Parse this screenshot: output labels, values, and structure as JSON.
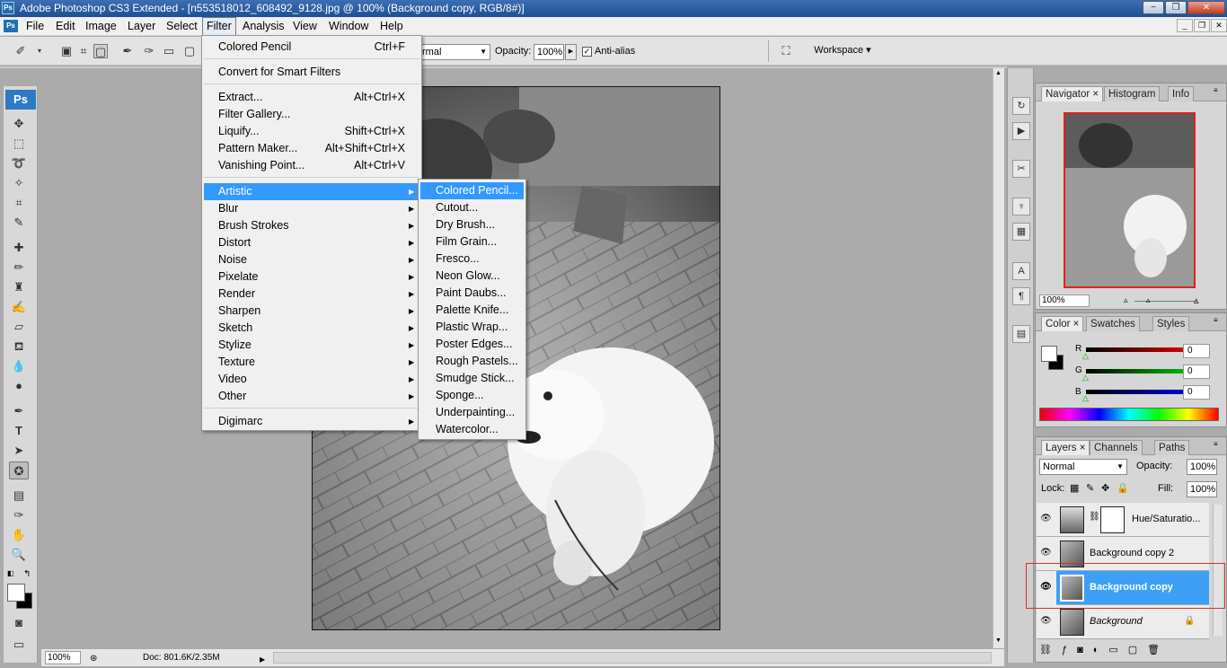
{
  "window": {
    "title": "Adobe Photoshop CS3 Extended - [n553518012_608492_9128.jpg @ 100% (Background copy, RGB/8#)]",
    "app_icon": "Ps",
    "minimize": "−",
    "restore": "❐",
    "close": "✕"
  },
  "menubar": {
    "items": [
      "File",
      "Edit",
      "Image",
      "Layer",
      "Select",
      "Filter",
      "Analysis",
      "View",
      "Window",
      "Help"
    ],
    "active": "Filter"
  },
  "options": {
    "mode_value": "rmal",
    "opacity_label": "Opacity:",
    "opacity_value": "100%",
    "antialias_label": "Anti-alias",
    "antialias_checked": true,
    "workspace_label": "Workspace ▾"
  },
  "filter_menu": {
    "last_filter": {
      "label": "Colored Pencil",
      "shortcut": "Ctrl+F"
    },
    "convert": "Convert for Smart Filters",
    "group1": [
      {
        "label": "Extract...",
        "shortcut": "Alt+Ctrl+X"
      },
      {
        "label": "Filter Gallery...",
        "shortcut": ""
      },
      {
        "label": "Liquify...",
        "shortcut": "Shift+Ctrl+X"
      },
      {
        "label": "Pattern Maker...",
        "shortcut": "Alt+Shift+Ctrl+X"
      },
      {
        "label": "Vanishing Point...",
        "shortcut": "Alt+Ctrl+V"
      }
    ],
    "submenus": [
      "Artistic",
      "Blur",
      "Brush Strokes",
      "Distort",
      "Noise",
      "Pixelate",
      "Render",
      "Sharpen",
      "Sketch",
      "Stylize",
      "Texture",
      "Video",
      "Other"
    ],
    "highlighted": "Artistic",
    "digimarc": "Digimarc"
  },
  "artistic_menu": {
    "items": [
      "Colored Pencil...",
      "Cutout...",
      "Dry Brush...",
      "Film Grain...",
      "Fresco...",
      "Neon Glow...",
      "Paint Daubs...",
      "Palette Knife...",
      "Plastic Wrap...",
      "Poster Edges...",
      "Rough Pastels...",
      "Smudge Stick...",
      "Sponge...",
      "Underpainting...",
      "Watercolor..."
    ],
    "highlighted": "Colored Pencil..."
  },
  "statusbar": {
    "zoom": "100%",
    "doc": "Doc: 801.6K/2.35M"
  },
  "navigator": {
    "tabs": [
      "Navigator",
      "Histogram",
      "Info"
    ],
    "zoom": "100%"
  },
  "color_panel": {
    "tabs": [
      "Color",
      "Swatches",
      "Styles"
    ],
    "channels": [
      {
        "name": "R",
        "value": "0",
        "color": "#e00000"
      },
      {
        "name": "G",
        "value": "0",
        "color": "#00c000"
      },
      {
        "name": "B",
        "value": "0",
        "color": "#0000e0"
      }
    ]
  },
  "layers_panel": {
    "tabs": [
      "Layers",
      "Channels",
      "Paths"
    ],
    "blend_mode": "Normal",
    "opacity_label": "Opacity:",
    "opacity_value": "100%",
    "lock_label": "Lock:",
    "fill_label": "Fill:",
    "fill_value": "100%",
    "layers": [
      {
        "name": "Hue/Saturatio...",
        "selected": false
      },
      {
        "name": "Background copy 2",
        "selected": false
      },
      {
        "name": "Background copy",
        "selected": true
      },
      {
        "name": "Background",
        "selected": false
      }
    ]
  },
  "colors": {
    "highlight": "#3399ff",
    "selected_layer": "#3da0f5",
    "annotation_box": "#d03030"
  }
}
